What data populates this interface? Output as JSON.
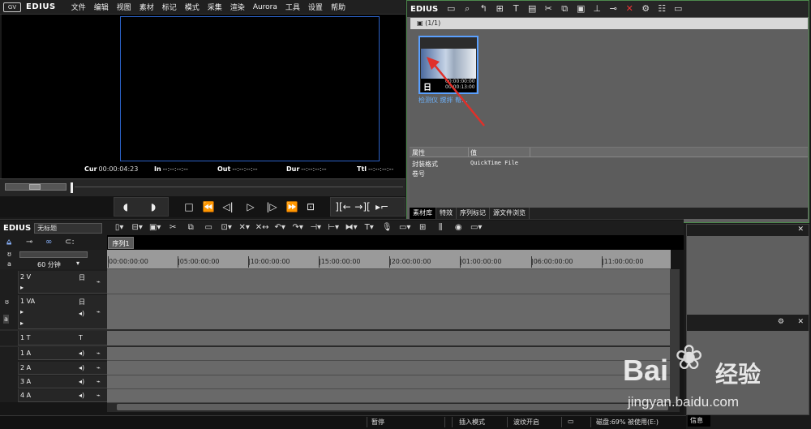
{
  "menubar": {
    "logo_badge": "GV",
    "brand": "EDIUS",
    "items": [
      "文件",
      "编辑",
      "视图",
      "素材",
      "标记",
      "模式",
      "采集",
      "渲染",
      "Aurora",
      "工具",
      "设置",
      "帮助"
    ]
  },
  "player": {
    "cur_label": "Cur",
    "cur_value": "00:00:04:23",
    "in_label": "In",
    "in_value": "--:--:--:--",
    "out_label": "Out",
    "out_value": "--:--:--:--",
    "dur_label": "Dur",
    "dur_value": "--:--:--:--",
    "ttl_label": "Ttl",
    "ttl_value": "--:--:--:--"
  },
  "bin": {
    "brand": "EDIUS",
    "path_text": "▣ (1/1)",
    "clip": {
      "name": "检测仪 搅拌 帮...",
      "timecode_in": "00:00:00:00",
      "timecode_out": "00:00:13:00",
      "type_glyph": "日"
    },
    "properties": {
      "header_key": "属性",
      "header_value": "值",
      "rows": [
        {
          "key": "封装格式",
          "value": "QuickTime File"
        },
        {
          "key": "卷号",
          "value": ""
        }
      ]
    },
    "tabs": [
      "素材库",
      "特效",
      "序列标记",
      "源文件浏览"
    ]
  },
  "timeline": {
    "brand": "EDIUS",
    "project_name": "无标题",
    "sequence_tab": "序列1",
    "zoom_label": "60 分钟",
    "ruler_ticks": [
      "00:00:00:00",
      "|05:00:00:00",
      "|10:00:00:00",
      "|15:00:00:00",
      "|20:00:00:00",
      "|01:00:00:00",
      "|06:00:00:00",
      "|11:00:00:00"
    ],
    "tracks": [
      {
        "name": "2 V"
      },
      {
        "name": "1 VA"
      },
      {
        "name": "1 T"
      },
      {
        "name": "1 A"
      },
      {
        "name": "2 A"
      },
      {
        "name": "3 A"
      },
      {
        "name": "4 A"
      }
    ]
  },
  "info_panel": {
    "tab": "信息"
  },
  "statusbar": {
    "state": "暂停",
    "insert_mode": "插入模式",
    "ripple": "波纹开启",
    "disk": "磁盘:69% 被使用(E:)"
  },
  "watermark": {
    "logo_text": "Bai",
    "logo_suffix": "经验",
    "url": "jingyan.baidu.com"
  },
  "colors": {
    "safe_frame": "#2c62c7",
    "clip_select": "#5aa0ff",
    "arrow": "#e0302a",
    "bin_border": "#4c8a4c"
  }
}
